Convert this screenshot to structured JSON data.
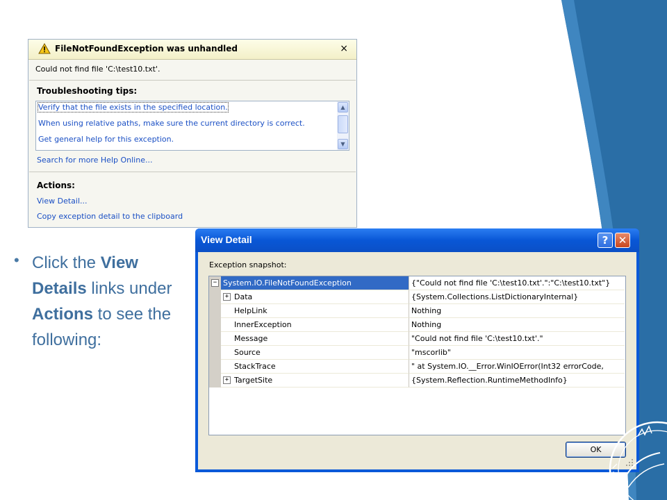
{
  "colors": {
    "accent_blue": "#2a6ea6",
    "link_blue": "#1a4fc4",
    "xp_title_blue": "#0a59d8",
    "selected_row": "#316ac5",
    "bullet_text": "#3f6f9e"
  },
  "assistant": {
    "title": "FileNotFoundException was unhandled",
    "close_glyph": "×",
    "message": "Could not find file 'C:\\test10.txt'.",
    "tips_heading": "Troubleshooting tips:",
    "tips": [
      "Verify that the file exists in the specified location.",
      "When using relative paths, make sure the current directory is correct.",
      "Get general help for this exception."
    ],
    "search_link": "Search for more Help Online...",
    "actions_heading": "Actions:",
    "actions": [
      "View Detail...",
      "Copy exception detail to the clipboard"
    ]
  },
  "bullet": {
    "dot": "•",
    "parts": [
      "Click the ",
      "View Details",
      " links under ",
      "Actions",
      " to see the following:"
    ]
  },
  "view_detail": {
    "title": "View Detail",
    "help_glyph": "?",
    "close_glyph": "✕",
    "snapshot_label": "Exception snapshot:",
    "root": {
      "name": "System.IO.FileNotFoundException",
      "value": "{\"Could not find file 'C:\\test10.txt'.\":\"C:\\test10.txt\"}",
      "expander": "⊟"
    },
    "properties": [
      {
        "name": "Data",
        "value": "{System.Collections.ListDictionaryInternal}",
        "expander": "+"
      },
      {
        "name": "HelpLink",
        "value": "Nothing"
      },
      {
        "name": "InnerException",
        "value": "Nothing"
      },
      {
        "name": "Message",
        "value": "\"Could not find file 'C:\\test10.txt'.\""
      },
      {
        "name": "Source",
        "value": "\"mscorlib\""
      },
      {
        "name": "StackTrace",
        "value": "\"   at System.IO.__Error.WinIOError(Int32 errorCode,"
      },
      {
        "name": "TargetSite",
        "value": "{System.Reflection.RuntimeMethodInfo}",
        "expander": "+"
      }
    ],
    "ok_label": "OK"
  }
}
